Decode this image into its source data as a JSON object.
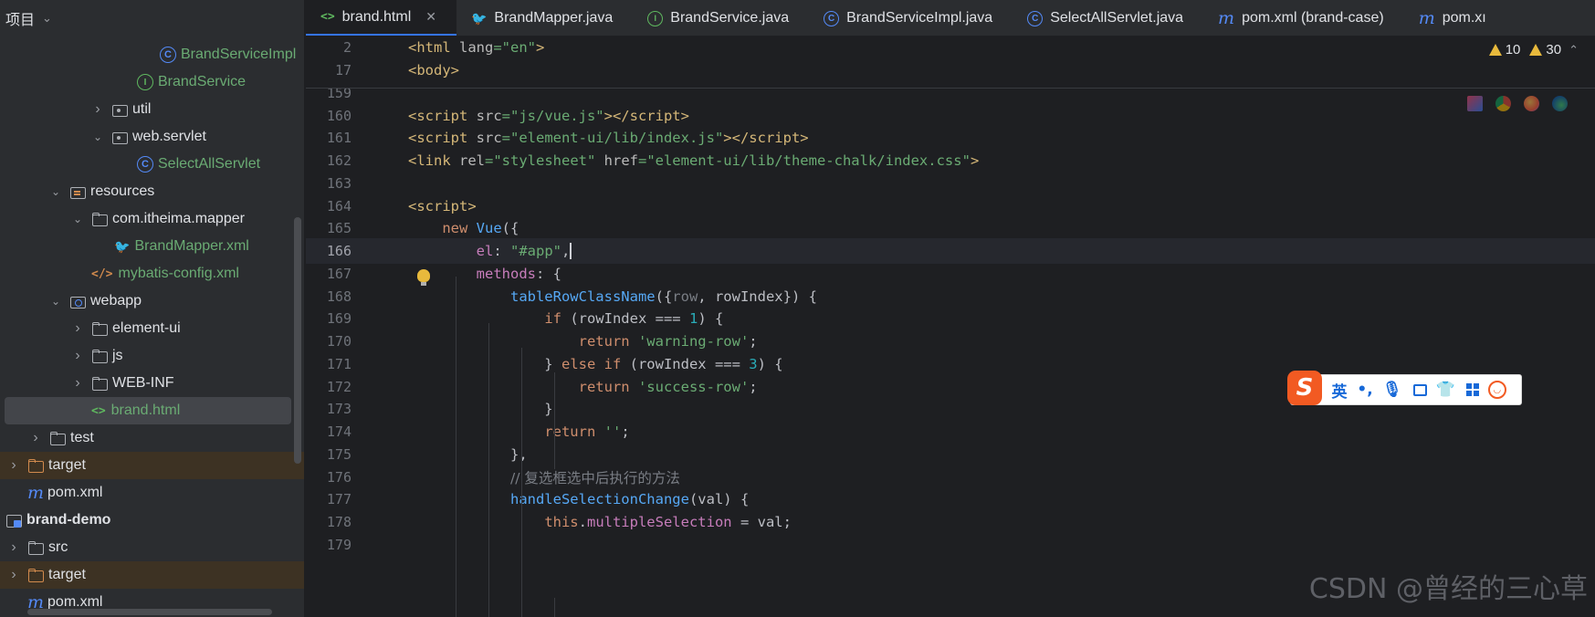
{
  "sidebar": {
    "title": "项目",
    "items": [
      {
        "label": "BrandServiceImpl",
        "icon": "class-icon",
        "indent": 175,
        "arrow": "",
        "color": "green"
      },
      {
        "label": "BrandService",
        "icon": "interface-icon",
        "indent": 150,
        "arrow": "",
        "color": "green"
      },
      {
        "label": "util",
        "icon": "package-icon",
        "indent": 100,
        "arrow": "collapsed",
        "color": ""
      },
      {
        "label": "web.servlet",
        "icon": "package-icon",
        "indent": 100,
        "arrow": "expanded",
        "color": ""
      },
      {
        "label": "SelectAllServlet",
        "icon": "class-icon",
        "indent": 150,
        "arrow": "",
        "color": "green"
      },
      {
        "label": "resources",
        "icon": "resources-folder-icon",
        "indent": 54,
        "arrow": "expanded",
        "color": ""
      },
      {
        "label": "com.itheima.mapper",
        "icon": "folder-icon",
        "indent": 78,
        "arrow": "expanded",
        "color": ""
      },
      {
        "label": "BrandMapper.xml",
        "icon": "mybatis-icon",
        "indent": 125,
        "arrow": "",
        "color": "green"
      },
      {
        "label": "mybatis-config.xml",
        "icon": "xml-icon",
        "indent": 100,
        "arrow": "",
        "color": "green"
      },
      {
        "label": "webapp",
        "icon": "web-folder-icon",
        "indent": 54,
        "arrow": "expanded",
        "color": ""
      },
      {
        "label": "element-ui",
        "icon": "folder-icon",
        "indent": 78,
        "arrow": "collapsed",
        "color": ""
      },
      {
        "label": "js",
        "icon": "folder-icon",
        "indent": 78,
        "arrow": "collapsed",
        "color": ""
      },
      {
        "label": "WEB-INF",
        "icon": "folder-icon",
        "indent": 78,
        "arrow": "collapsed",
        "color": ""
      },
      {
        "label": "brand.html",
        "icon": "html-icon",
        "indent": 100,
        "arrow": "",
        "color": "green",
        "selected": true
      },
      {
        "label": "test",
        "icon": "folder-icon",
        "indent": 32,
        "arrow": "collapsed",
        "color": ""
      },
      {
        "label": "target",
        "icon": "excluded-folder-icon",
        "indent": 8,
        "arrow": "collapsed",
        "color": "",
        "excluded": true
      },
      {
        "label": "pom.xml",
        "icon": "maven-icon",
        "indent": 30,
        "arrow": "",
        "color": ""
      },
      {
        "label": "brand-demo",
        "icon": "module-icon",
        "indent": 6,
        "arrow": "",
        "color": "",
        "bold": true
      },
      {
        "label": "src",
        "icon": "folder-icon",
        "indent": 8,
        "arrow": "collapsed",
        "color": ""
      },
      {
        "label": "target",
        "icon": "excluded-folder-icon",
        "indent": 8,
        "arrow": "collapsed",
        "color": "",
        "excluded": true
      },
      {
        "label": "pom.xml",
        "icon": "maven-icon",
        "indent": 30,
        "arrow": "",
        "color": ""
      }
    ]
  },
  "tabs": [
    {
      "label": "brand.html",
      "icon": "html-icon",
      "active": true,
      "closable": true
    },
    {
      "label": "BrandMapper.java",
      "icon": "mybatis-icon"
    },
    {
      "label": "BrandService.java",
      "icon": "interface-icon"
    },
    {
      "label": "BrandServiceImpl.java",
      "icon": "class-icon"
    },
    {
      "label": "SelectAllServlet.java",
      "icon": "class-icon"
    },
    {
      "label": "pom.xml (brand-case)",
      "icon": "maven-icon"
    },
    {
      "label": "pom.xı",
      "icon": "maven-icon"
    }
  ],
  "inspections": {
    "warnings_a": "10",
    "warnings_b": "30"
  },
  "sticky_lines": [
    {
      "num": "2",
      "html": "<span class='t-tag'>&lt;html </span><span class='t-attr'>lang</span><span class='t-str'>=\"en\"</span><span class='t-tag'>&gt;</span>"
    },
    {
      "num": "17",
      "html": "<span class='t-tag'>&lt;body&gt;</span>"
    }
  ],
  "code_lines": [
    {
      "num": "159",
      "html": ""
    },
    {
      "num": "160",
      "html": "<span class='t-tag'>&lt;script </span><span class='t-attr'>src</span><span class='t-str'>=\"js/vue.js\"</span><span class='t-tag'>&gt;&lt;/script&gt;</span>"
    },
    {
      "num": "161",
      "html": "<span class='t-tag'>&lt;script </span><span class='t-attr'>src</span><span class='t-str'>=\"element-ui/lib/index.js\"</span><span class='t-tag'>&gt;&lt;/script&gt;</span>"
    },
    {
      "num": "162",
      "html": "<span class='t-tag'>&lt;link </span><span class='t-attr'>rel</span><span class='t-str'>=\"stylesheet\" </span><span class='t-attr'>href</span><span class='t-str'>=\"element-ui/lib/theme-chalk/index.css\"</span><span class='t-tag'>&gt;</span>"
    },
    {
      "num": "163",
      "html": ""
    },
    {
      "num": "164",
      "html": "<span class='t-tag'>&lt;script&gt;</span>"
    },
    {
      "num": "165",
      "html": "    <span class='t-kw'>new </span><span class='t-fn'>Vue</span>({"
    },
    {
      "num": "166",
      "html": "        <span class='t-prop'>el</span>: <span class='t-str'>\"#app\"</span>,<span class='caret'></span>",
      "current": true
    },
    {
      "num": "167",
      "html": "        <span class='t-prop'>methods</span>: {"
    },
    {
      "num": "168",
      "html": "            <span class='t-fn'>tableRowClassName</span>({<span class='t-param'>row</span>, rowIndex}) {"
    },
    {
      "num": "169",
      "html": "                <span class='t-kw'>if </span>(rowIndex === <span class='t-num'>1</span>) {"
    },
    {
      "num": "170",
      "html": "                    <span class='t-kw'>return </span><span class='t-str'>'warning-row'</span>;"
    },
    {
      "num": "171",
      "html": "                } <span class='t-kw'>else if </span>(rowIndex === <span class='t-num'>3</span>) {"
    },
    {
      "num": "172",
      "html": "                    <span class='t-kw'>return </span><span class='t-str'>'success-row'</span>;"
    },
    {
      "num": "173",
      "html": "                }"
    },
    {
      "num": "174",
      "html": "                <span class='t-kw'>return </span><span class='t-str'>''</span>;"
    },
    {
      "num": "175",
      "html": "            },"
    },
    {
      "num": "176",
      "html": "            <span class='t-cmt'>// 复选框选中后执行的方法</span>"
    },
    {
      "num": "177",
      "html": "            <span class='t-fn'>handleSelectionChange</span>(val) {"
    },
    {
      "num": "178",
      "html": "                <span class='t-kw'>this</span>.<span class='t-prop'>multipleSelection</span> = val;"
    },
    {
      "num": "179",
      "html": ""
    }
  ],
  "ime": {
    "logo": "S",
    "lang": "英",
    "punct": "•,"
  },
  "watermark": "CSDN @曾经的三心草",
  "colors": {
    "accent": "#3574f0",
    "green_file": "#6aab73",
    "tag": "#d5b778",
    "string": "#6aab73",
    "keyword": "#cf8e6d",
    "function": "#56a8f5",
    "property": "#c77dbb",
    "number": "#2aacb8"
  }
}
